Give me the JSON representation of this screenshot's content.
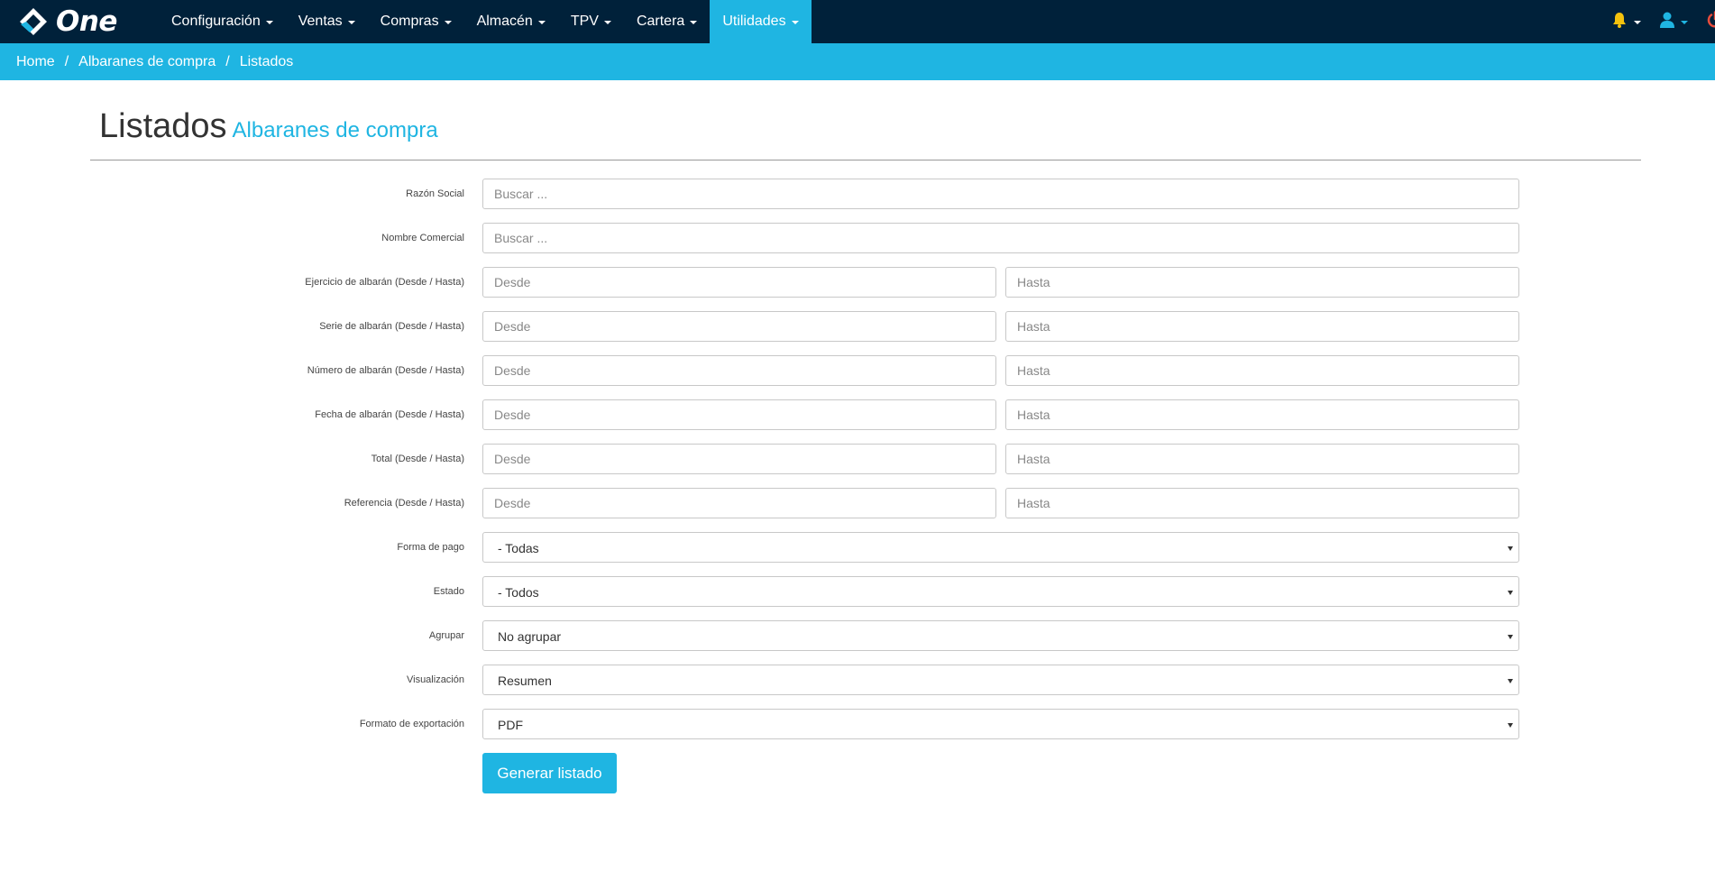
{
  "app": {
    "brand_name": "One",
    "accent_color": "#1fb5e2",
    "nav_bg_color": "#00213a"
  },
  "nav": {
    "items": [
      {
        "label": "Configuración",
        "active": false
      },
      {
        "label": "Ventas",
        "active": false
      },
      {
        "label": "Compras",
        "active": false
      },
      {
        "label": "Almacén",
        "active": false
      },
      {
        "label": "TPV",
        "active": false
      },
      {
        "label": "Cartera",
        "active": false
      },
      {
        "label": "Utilidades",
        "active": true
      }
    ],
    "right_icons": [
      "bell-icon",
      "user-icon",
      "power-icon"
    ]
  },
  "breadcrumb": {
    "items": [
      "Home",
      "Albaranes de compra",
      "Listados"
    ],
    "separator": "/"
  },
  "header": {
    "title": "Listados",
    "subtitle": "Albaranes de compra"
  },
  "form": {
    "razon_social": {
      "label": "Razón Social",
      "placeholder": "Buscar ..."
    },
    "nombre_comercial": {
      "label": "Nombre Comercial",
      "placeholder": "Buscar ..."
    },
    "ejercicio": {
      "label": "Ejercicio de albarán (Desde / Hasta)",
      "from_placeholder": "Desde",
      "to_placeholder": "Hasta"
    },
    "serie": {
      "label": "Serie de albarán (Desde / Hasta)",
      "from_placeholder": "Desde",
      "to_placeholder": "Hasta"
    },
    "numero": {
      "label": "Número de albarán (Desde / Hasta)",
      "from_placeholder": "Desde",
      "to_placeholder": "Hasta"
    },
    "fecha": {
      "label": "Fecha de albarán (Desde / Hasta)",
      "from_placeholder": "Desde",
      "to_placeholder": "Hasta"
    },
    "total": {
      "label": "Total (Desde / Hasta)",
      "from_placeholder": "Desde",
      "to_placeholder": "Hasta"
    },
    "referencia": {
      "label": "Referencia (Desde / Hasta)",
      "from_placeholder": "Desde",
      "to_placeholder": "Hasta"
    },
    "forma_pago": {
      "label": "Forma de pago",
      "value": "- Todas"
    },
    "estado": {
      "label": "Estado",
      "value": "- Todos"
    },
    "agrupar": {
      "label": "Agrupar",
      "value": "No agrupar"
    },
    "visualizacion": {
      "label": "Visualización",
      "value": "Resumen"
    },
    "formato": {
      "label": "Formato de exportación",
      "value": "PDF"
    },
    "submit_label": "Generar listado"
  }
}
